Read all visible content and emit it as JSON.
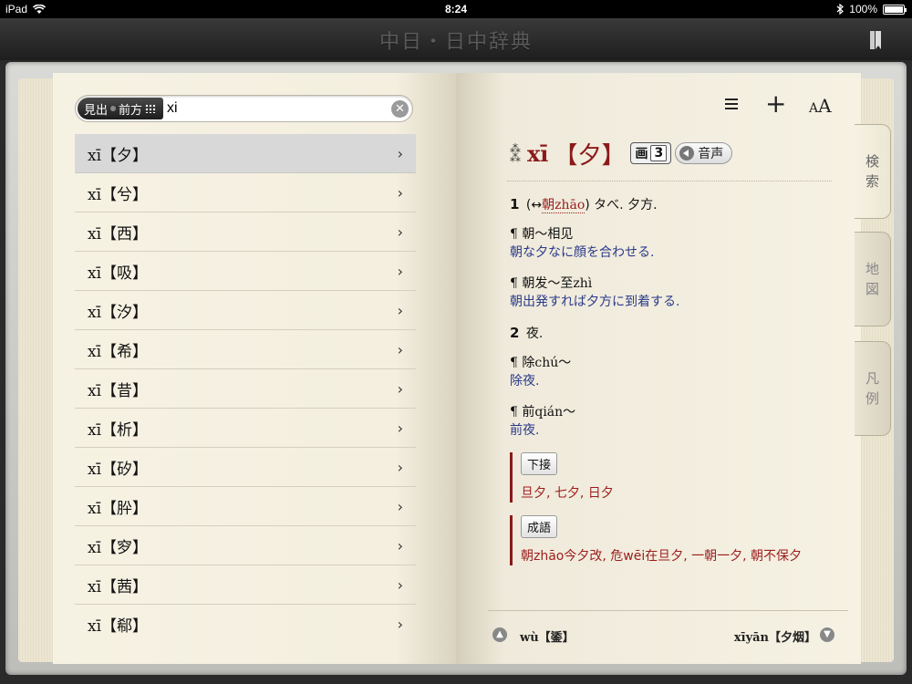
{
  "status_bar": {
    "device": "iPad",
    "time": "8:24",
    "battery": "100%"
  },
  "title_bar": {
    "title": "中日・日中辞典"
  },
  "search": {
    "mode_left": "見出",
    "mode_right": "前方",
    "query": "xi"
  },
  "results": [
    {
      "label": "xī【夕】"
    },
    {
      "label": "xī【兮】"
    },
    {
      "label": "xī【西】"
    },
    {
      "label": "xī【吸】"
    },
    {
      "label": "xī【汐】"
    },
    {
      "label": "xī【希】"
    },
    {
      "label": "xī【昔】"
    },
    {
      "label": "xī【析】"
    },
    {
      "label": "xī【矽】"
    },
    {
      "label": "xī【肸】"
    },
    {
      "label": "xī【穸】"
    },
    {
      "label": "xī【茜】"
    },
    {
      "label": "xī【郗】"
    }
  ],
  "entry": {
    "pinyin": "xī",
    "kanji": "【夕】",
    "stroke_label": "画",
    "stroke_count": "3",
    "audio_label": "音声",
    "sense1_num": "1",
    "sense1_pre": "(↔",
    "sense1_link": "朝zhāo",
    "sense1_post": ") タべ. 夕方.",
    "ex1_cn": "¶ 朝～相见",
    "ex1_jp": "朝な夕なに顔を合わせる.",
    "ex2_cn": "¶ 朝发～至zhì",
    "ex2_jp": "朝出発すれば夕方に到着する.",
    "sense2_num": "2",
    "sense2_text": "夜.",
    "ex3_cn": "¶ 除chú～",
    "ex3_jp": "除夜.",
    "ex4_cn": "¶ 前qián～",
    "ex4_jp": "前夜.",
    "box1_label": "下接",
    "box1_content": "旦夕, 七夕, 日夕",
    "box2_label": "成語",
    "box2_content": "朝zhāo今夕改, 危wēi在旦夕, 一朝一夕, 朝不保夕"
  },
  "footer": {
    "prev": "wù【鋈】",
    "next": "xīyān【夕烟】"
  },
  "side_tabs": [
    {
      "label_top": "検",
      "label_bottom": "索"
    },
    {
      "label_top": "地",
      "label_bottom": "図"
    },
    {
      "label_top": "凡",
      "label_bottom": "例"
    }
  ],
  "colors": {
    "accent_red": "#8b1a1a",
    "example_blue": "#2a3a8a"
  }
}
